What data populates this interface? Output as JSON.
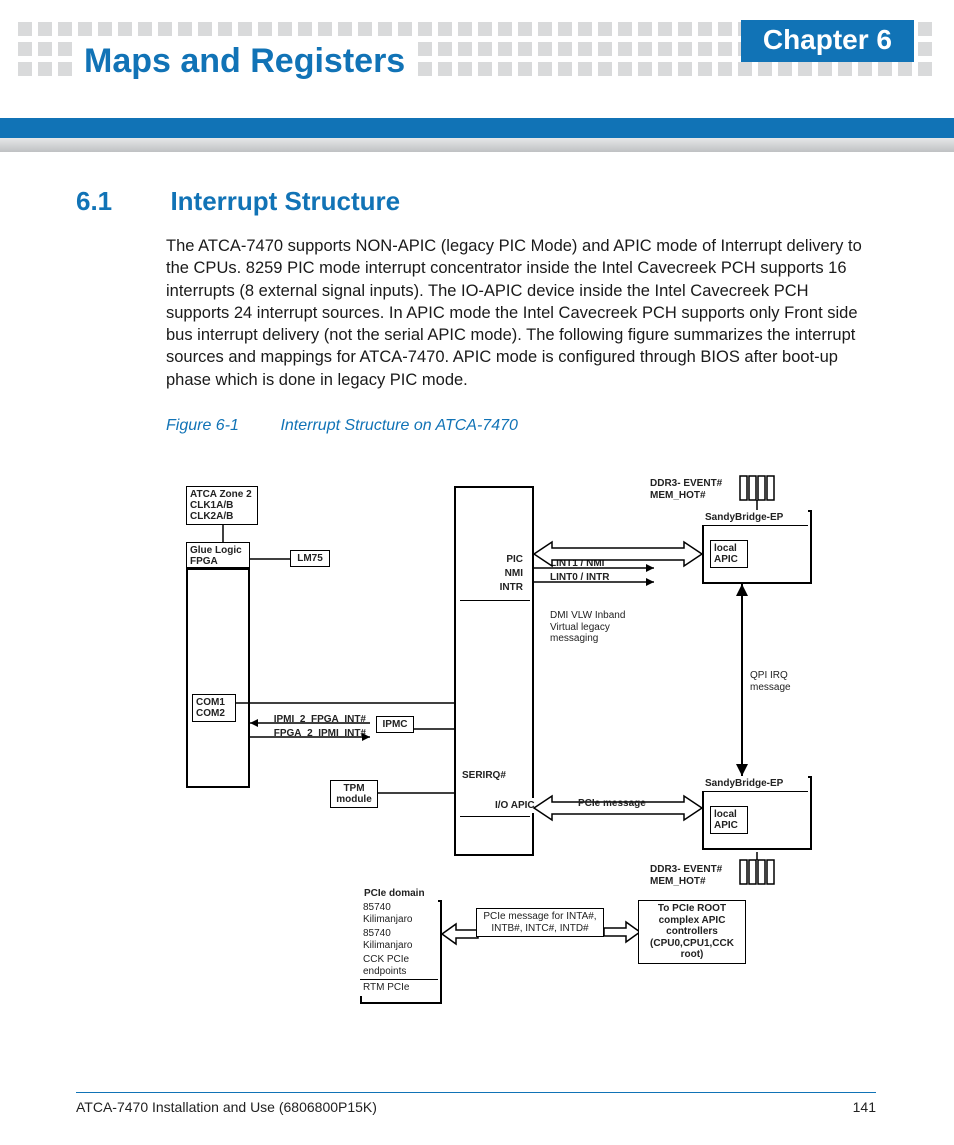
{
  "header": {
    "chapter_badge": "Chapter 6",
    "chapter_title": "Maps and Registers"
  },
  "section": {
    "number": "6.1",
    "title": "Interrupt Structure",
    "body": "The ATCA-7470 supports NON-APIC (legacy PIC Mode) and APIC mode of Interrupt delivery to the CPUs. 8259 PIC mode interrupt concentrator inside the Intel Cavecreek PCH supports 16 interrupts (8 external signal inputs). The IO-APIC device inside the Intel Cavecreek PCH supports 24 interrupt sources. In APIC mode the Intel Cavecreek PCH supports only Front side bus interrupt delivery (not the serial APIC mode). The following figure summarizes the interrupt sources and mappings for ATCA-7470. APIC mode is configured through BIOS after boot-up phase which is done in legacy PIC mode."
  },
  "figure": {
    "label": "Figure 6-1",
    "caption": "Interrupt Structure on ATCA-7470"
  },
  "diagram": {
    "atca_zone": "ATCA Zone 2 CLK1A/B CLK2A/B",
    "glue_logic": "Glue Logic FPGA",
    "lm75": "LM75",
    "com": "COM1 COM2",
    "ipmc": "IPMC",
    "ipmi2fpga": "IPMI_2_FPGA_INT#",
    "fpga2ipmi": "FPGA_2_IPMI_INT#",
    "tpm": "TPM module",
    "pic": "PIC",
    "nmi": "NMI",
    "intr": "INTR",
    "lint1": "LINT1 / NMI",
    "lint0": "LINT0 / INTR",
    "dmi": "DMI VLW Inband Virtual legacy messaging",
    "serirq": "SERIRQ#",
    "ioapic": "I/O APIC",
    "pcie_msg": "PCIe message",
    "sandybridge": "SandyBridge-EP",
    "local_apic": "local APIC",
    "ddr3": "DDR3- EVENT# MEM_HOT#",
    "qpi": "QPI IRQ message",
    "pcie_domain_title": "PCIe domain",
    "pd1": "85740 Kilimanjaro",
    "pd2": "85740 Kilimanjaro",
    "pd3": "CCK PCIe endpoints",
    "pd4": "RTM PCIe",
    "intmsg": "PCIe message for INTA#, INTB#, INTC#, INTD#",
    "rootcomplex": "To PCIe ROOT complex APIC controllers (CPU0,CPU1,CCK root)"
  },
  "footer": {
    "left": "ATCA-7470 Installation and Use (6806800P15K)",
    "page": "141"
  }
}
